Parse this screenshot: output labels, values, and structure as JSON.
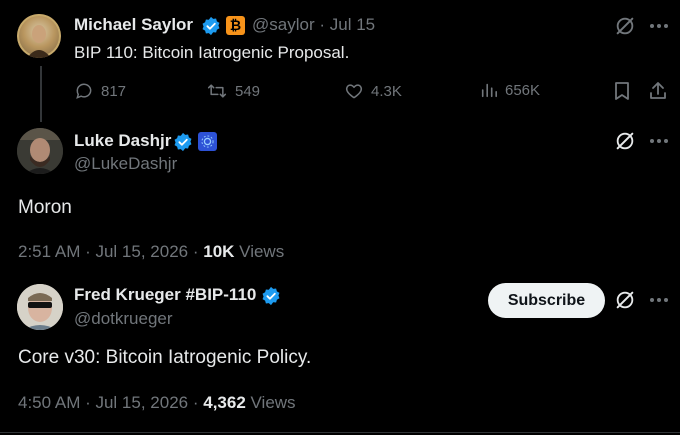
{
  "colors": {
    "background": "#000000",
    "text": "#e7e9ea",
    "muted": "#71767b",
    "verified": "#1d9bf0",
    "bitcoin_badge": "#f7931a"
  },
  "tweet1": {
    "author": "Michael Saylor",
    "handle": "@saylor",
    "separator": "·",
    "date": "Jul 15",
    "text": "BIP 110: Bitcoin Iatrogenic Proposal.",
    "actions": {
      "replies": "817",
      "retweets": "549",
      "likes": "4.3K",
      "views": "656K"
    },
    "icons": [
      "grok-icon",
      "more-icon",
      "reply-icon",
      "retweet-icon",
      "like-icon",
      "views-icon",
      "bookmark-icon",
      "share-icon"
    ]
  },
  "tweet2": {
    "author": "Luke Dashjr",
    "handle": "@LukeDashjr",
    "text": "Moron",
    "time": "2:51 AM · Jul 15, 2026 ·",
    "views_count": "10K",
    "views_label": "Views"
  },
  "tweet3": {
    "author": "Fred Krueger #BIP-110",
    "handle": "@dotkrueger",
    "subscribe_label": "Subscribe",
    "text": "Core v30: Bitcoin Iatrogenic Policy.",
    "time": "4:50 AM · Jul 15, 2026 ·",
    "views_count": "4,362",
    "views_label": "Views"
  }
}
